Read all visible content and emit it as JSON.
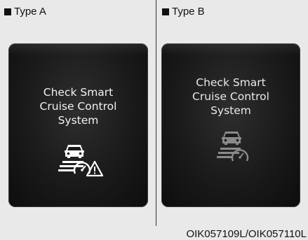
{
  "type_a": {
    "label": "Type A",
    "message_lines": [
      "Check Smart",
      "Cruise Control",
      "System"
    ],
    "icon": "smart-cruise-warning-icon"
  },
  "type_b": {
    "label": "Type B",
    "message_lines": [
      "Check Smart",
      "Cruise Control",
      "System"
    ],
    "icon": "smart-cruise-gray-icon"
  },
  "footer": {
    "code": "OIK057109L/OIK057110L"
  },
  "colors": {
    "background": "#e9e9e9",
    "panel": "#1a1a1a",
    "text": "#f2f2f2",
    "icon_gray": "#8a8a8a"
  }
}
